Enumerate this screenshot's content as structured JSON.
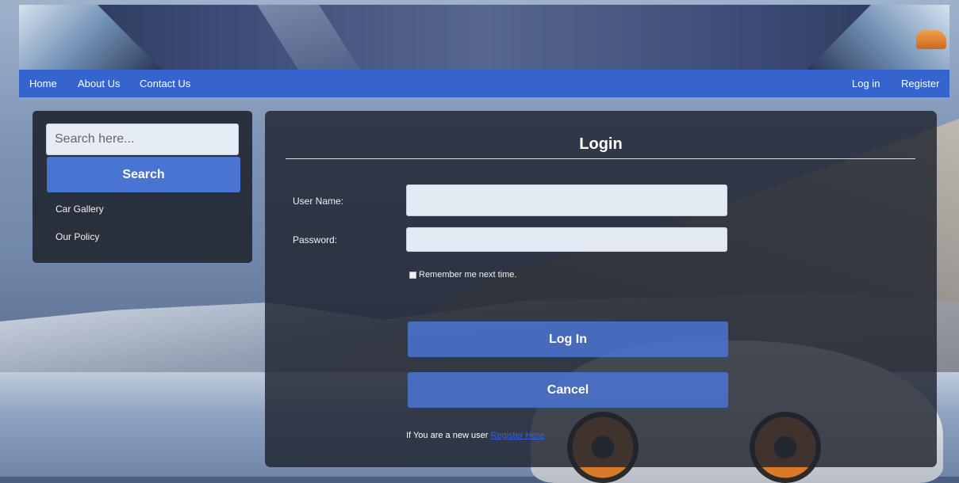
{
  "nav": {
    "home": "Home",
    "about": "About Us",
    "contact": "Contact Us",
    "login": "Log in",
    "register": "Register"
  },
  "sidebar": {
    "search_placeholder": "Search here...",
    "search_button": "Search",
    "links": [
      "Car Gallery",
      "Our Policy"
    ]
  },
  "login": {
    "title": "Login",
    "username_label": "User Name:",
    "password_label": "Password:",
    "remember_label": "Remember me next time.",
    "login_button": "Log In",
    "cancel_button": "Cancel",
    "new_user_text": "If You are a new user",
    "register_link": "Register Here"
  },
  "colors": {
    "nav_bar": "#3564cf",
    "button": "#4a74d2",
    "panel": "#242934"
  }
}
